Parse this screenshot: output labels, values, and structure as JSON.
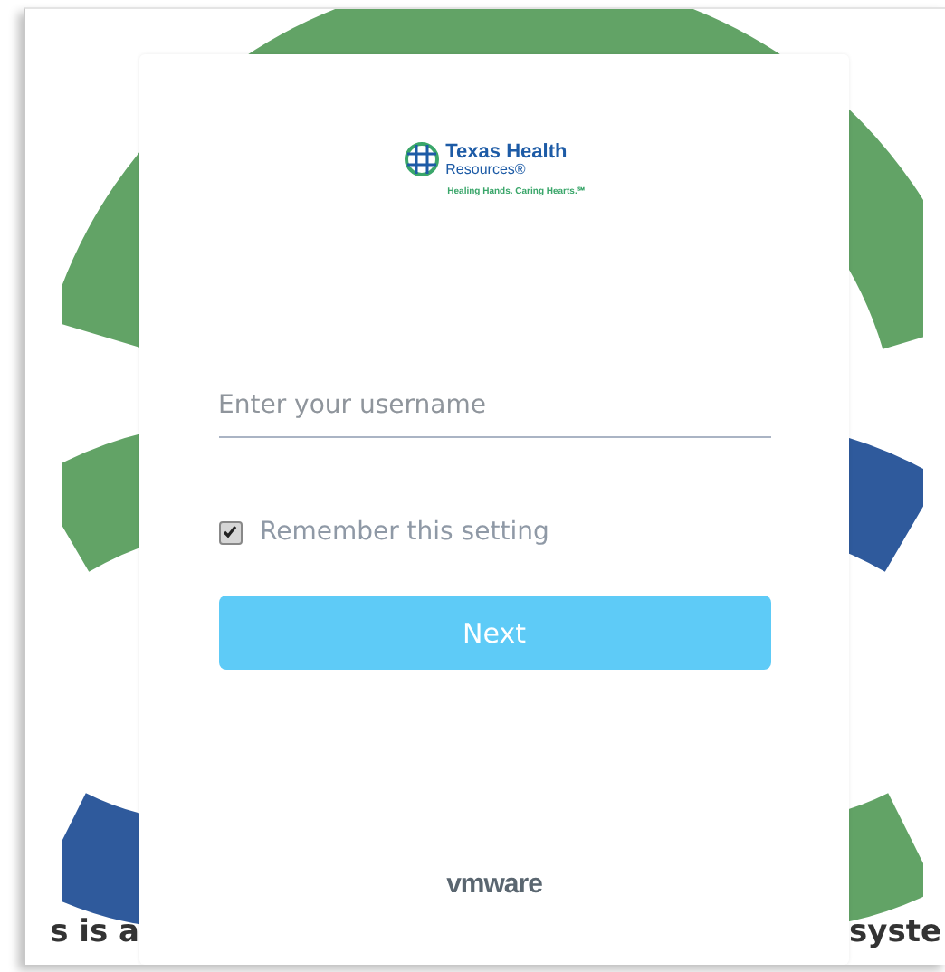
{
  "logo": {
    "name_line1": "Texas Health",
    "name_line2": "Resources®",
    "tagline": "Healing Hands. Caring Hearts.℠"
  },
  "username": {
    "placeholder": "Enter your username"
  },
  "remember": {
    "label": "Remember this setting",
    "checked": true
  },
  "next_button": {
    "label": "Next"
  },
  "footer_brand": "vmware",
  "background_text": {
    "left": "s is a",
    "right": "syste"
  }
}
